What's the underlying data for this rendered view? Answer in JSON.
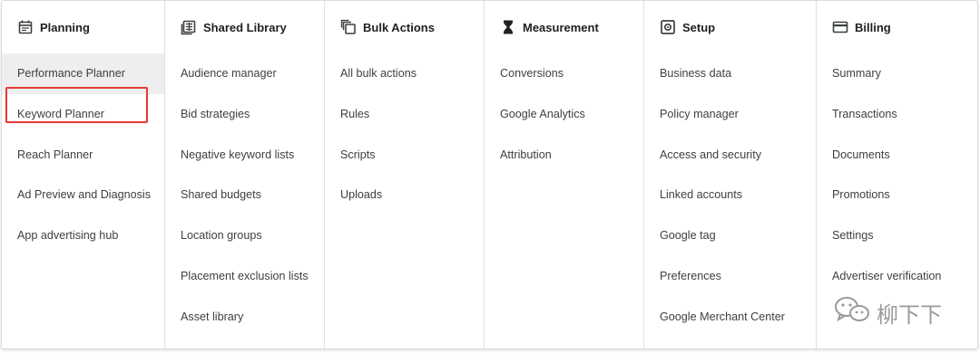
{
  "columns": [
    {
      "title": "Planning",
      "icon": "calendar-icon",
      "items": [
        "Performance Planner",
        "Keyword Planner",
        "Reach Planner",
        "Ad Preview and Diagnosis",
        "App advertising hub"
      ]
    },
    {
      "title": "Shared Library",
      "icon": "library-grid-icon",
      "items": [
        "Audience manager",
        "Bid strategies",
        "Negative keyword lists",
        "Shared budgets",
        "Location groups",
        "Placement exclusion lists",
        "Asset library"
      ]
    },
    {
      "title": "Bulk Actions",
      "icon": "copy-stack-icon",
      "items": [
        "All bulk actions",
        "Rules",
        "Scripts",
        "Uploads"
      ]
    },
    {
      "title": "Measurement",
      "icon": "hourglass-icon",
      "items": [
        "Conversions",
        "Google Analytics",
        "Attribution"
      ]
    },
    {
      "title": "Setup",
      "icon": "settings-box-icon",
      "items": [
        "Business data",
        "Policy manager",
        "Access and security",
        "Linked accounts",
        "Google tag",
        "Preferences",
        "Google Merchant Center"
      ]
    },
    {
      "title": "Billing",
      "icon": "credit-card-icon",
      "items": [
        "Summary",
        "Transactions",
        "Documents",
        "Promotions",
        "Settings",
        "Advertiser verification"
      ]
    }
  ],
  "watermark": {
    "text": "柳下下",
    "icon": "wechat-icon"
  },
  "colors": {
    "highlight_border": "#e53935",
    "selected_bg": "#eeeeee",
    "divider": "#e0e0e0"
  }
}
